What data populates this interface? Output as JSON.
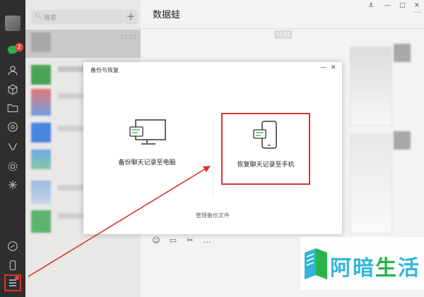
{
  "chatlist": {
    "search_placeholder": "搜索",
    "first_time": "17:22"
  },
  "chat": {
    "title": "数据蛙",
    "time_pill": "17:21"
  },
  "dialog": {
    "title": "备份与恢复",
    "backup_label": "备份聊天记录至电脑",
    "restore_label": "恢复聊天记录至手机",
    "manage_label": "管理备份文件"
  },
  "nav": {
    "badge": "2"
  },
  "watermark": {
    "chars": [
      "阿",
      "暗",
      "生",
      "活"
    ]
  },
  "colors": {
    "highlight_red": "#d7332b",
    "badge_red": "#e5473f",
    "logo_cyan": "#31b6d8",
    "logo_green": "#2bb24c"
  },
  "icons": [
    "chat-icon",
    "contacts-icon",
    "box-icon",
    "folder-icon",
    "moments-icon",
    "mini-icon",
    "settings-icon",
    "search-icon",
    "plus-icon",
    "phone-icon",
    "menu-icon",
    "computer-icon"
  ]
}
